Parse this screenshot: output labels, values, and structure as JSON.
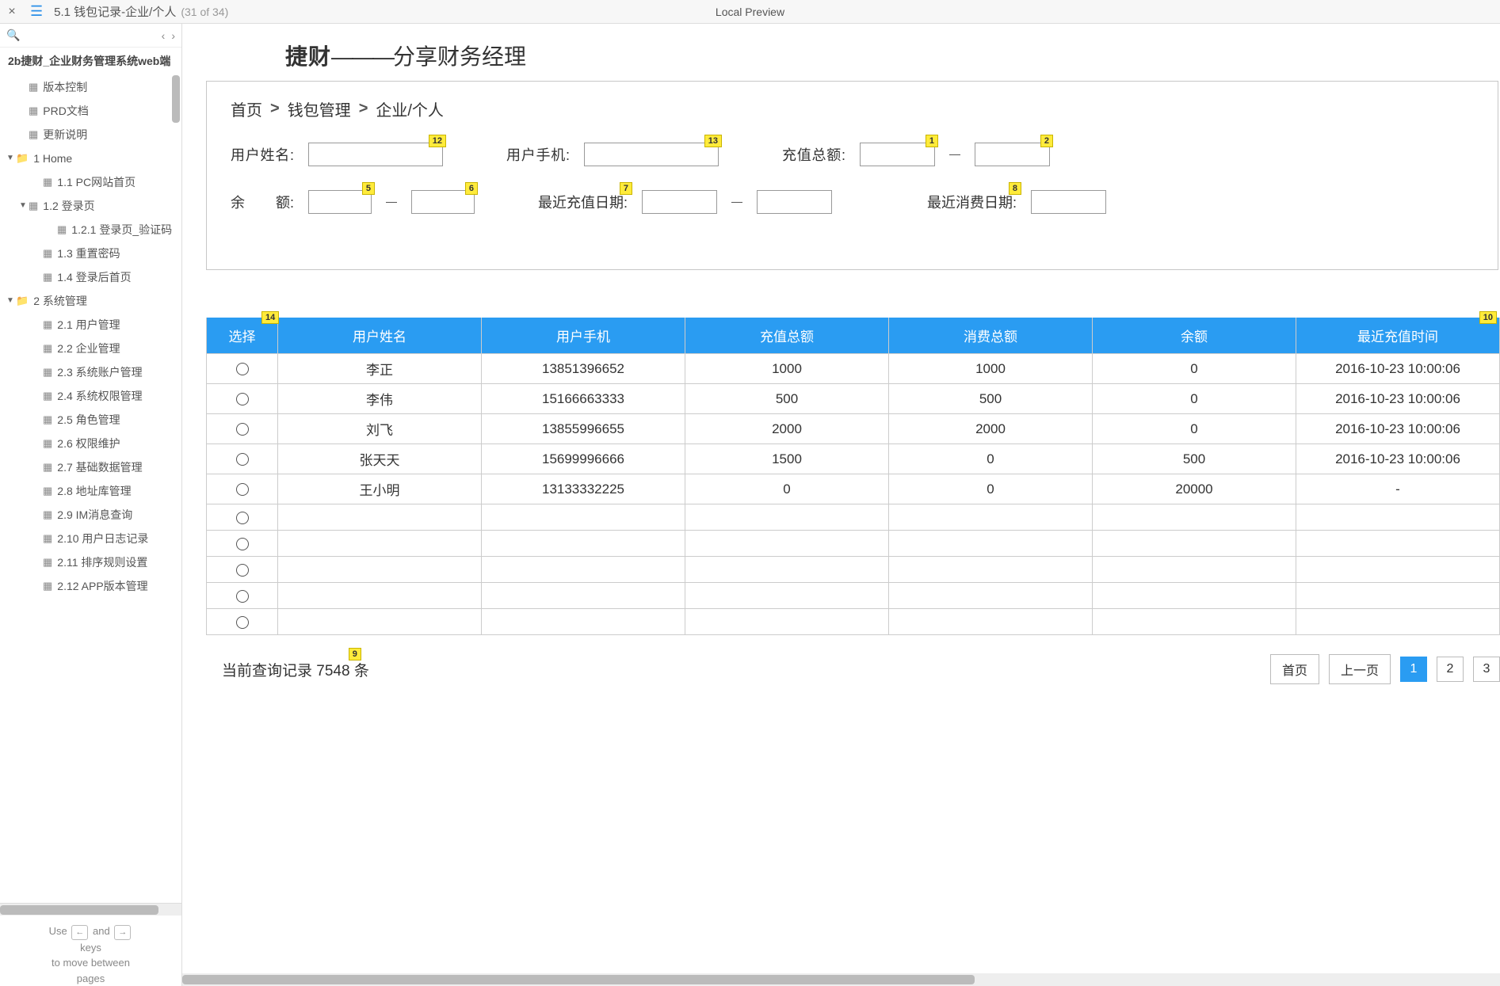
{
  "topbar": {
    "tab_title": "5.1 钱包记录-企业/个人",
    "tab_count": "(31 of 34)",
    "preview_label": "Local Preview"
  },
  "sidebar": {
    "project_title": "2b捷财_企业财务管理系统web端",
    "items": [
      {
        "label": "版本控制",
        "type": "doc",
        "indent": 1
      },
      {
        "label": "PRD文档",
        "type": "doc",
        "indent": 1
      },
      {
        "label": "更新说明",
        "type": "doc",
        "indent": 1
      },
      {
        "label": "1 Home",
        "type": "folder",
        "indent": 0,
        "expanded": true
      },
      {
        "label": "1.1 PC网站首页",
        "type": "doc",
        "indent": 2
      },
      {
        "label": "1.2 登录页",
        "type": "doc",
        "indent": 1,
        "expanded": true
      },
      {
        "label": "1.2.1 登录页_验证码",
        "type": "doc",
        "indent": 3
      },
      {
        "label": "1.3 重置密码",
        "type": "doc",
        "indent": 2
      },
      {
        "label": "1.4 登录后首页",
        "type": "doc",
        "indent": 2
      },
      {
        "label": "2 系统管理",
        "type": "folder",
        "indent": 0,
        "expanded": true
      },
      {
        "label": "2.1 用户管理",
        "type": "doc",
        "indent": 2
      },
      {
        "label": "2.2 企业管理",
        "type": "doc",
        "indent": 2
      },
      {
        "label": "2.3 系统账户管理",
        "type": "doc",
        "indent": 2
      },
      {
        "label": "2.4 系统权限管理",
        "type": "doc",
        "indent": 2
      },
      {
        "label": "2.5 角色管理",
        "type": "doc",
        "indent": 2
      },
      {
        "label": "2.6 权限维护",
        "type": "doc",
        "indent": 2
      },
      {
        "label": "2.7 基础数据管理",
        "type": "doc",
        "indent": 2
      },
      {
        "label": "2.8 地址库管理",
        "type": "doc",
        "indent": 2
      },
      {
        "label": "2.9 IM消息查询",
        "type": "doc",
        "indent": 2
      },
      {
        "label": "2.10 用户日志记录",
        "type": "doc",
        "indent": 2
      },
      {
        "label": "2.11 排序规则设置",
        "type": "doc",
        "indent": 2
      },
      {
        "label": "2.12 APP版本管理",
        "type": "doc",
        "indent": 2
      }
    ],
    "hint_use": "Use",
    "hint_and": "and",
    "hint_keys": "keys",
    "hint_move": "to move between",
    "hint_pages": "pages",
    "hint_left": "←",
    "hint_right": "→"
  },
  "brand": {
    "strong": "捷财",
    "sep": "———",
    "tail": "分享财务经理"
  },
  "breadcrumb": {
    "items": [
      "首页",
      "钱包管理",
      "企业/个人"
    ],
    "sep": ">"
  },
  "filters": {
    "username_label": "用户姓名:",
    "phone_label": "用户手机:",
    "recharge_total_label": "充值总额:",
    "balance_label_a": "余",
    "balance_label_b": "额:",
    "recent_recharge_label": "最近充值日期:",
    "recent_consume_label": "最近消费日期:"
  },
  "notes": {
    "n1": "1",
    "n2": "2",
    "n5": "5",
    "n6": "6",
    "n7": "7",
    "n8": "8",
    "n9": "9",
    "n10": "10",
    "n12": "12",
    "n13": "13",
    "n14": "14"
  },
  "table": {
    "headers": [
      "选择",
      "用户姓名",
      "用户手机",
      "充值总额",
      "消费总额",
      "余额",
      "最近充值时间"
    ],
    "rows": [
      [
        "李正",
        "13851396652",
        "1000",
        "1000",
        "0",
        "2016-10-23 10:00:06"
      ],
      [
        "李伟",
        "15166663333",
        "500",
        "500",
        "0",
        "2016-10-23 10:00:06"
      ],
      [
        "刘飞",
        "13855996655",
        "2000",
        "2000",
        "0",
        "2016-10-23 10:00:06"
      ],
      [
        "张天天",
        "15699996666",
        "1500",
        "0",
        "500",
        "2016-10-23 10:00:06"
      ],
      [
        "王小明",
        "13133332225",
        "0",
        "0",
        "20000",
        "-"
      ]
    ],
    "empty_rows": 5
  },
  "pager": {
    "summary_prefix": "当前查询记录 ",
    "summary_count": "7548",
    "summary_suffix": " 条",
    "first": "首页",
    "prev": "上一页",
    "p1": "1",
    "p2": "2",
    "p3": "3"
  }
}
